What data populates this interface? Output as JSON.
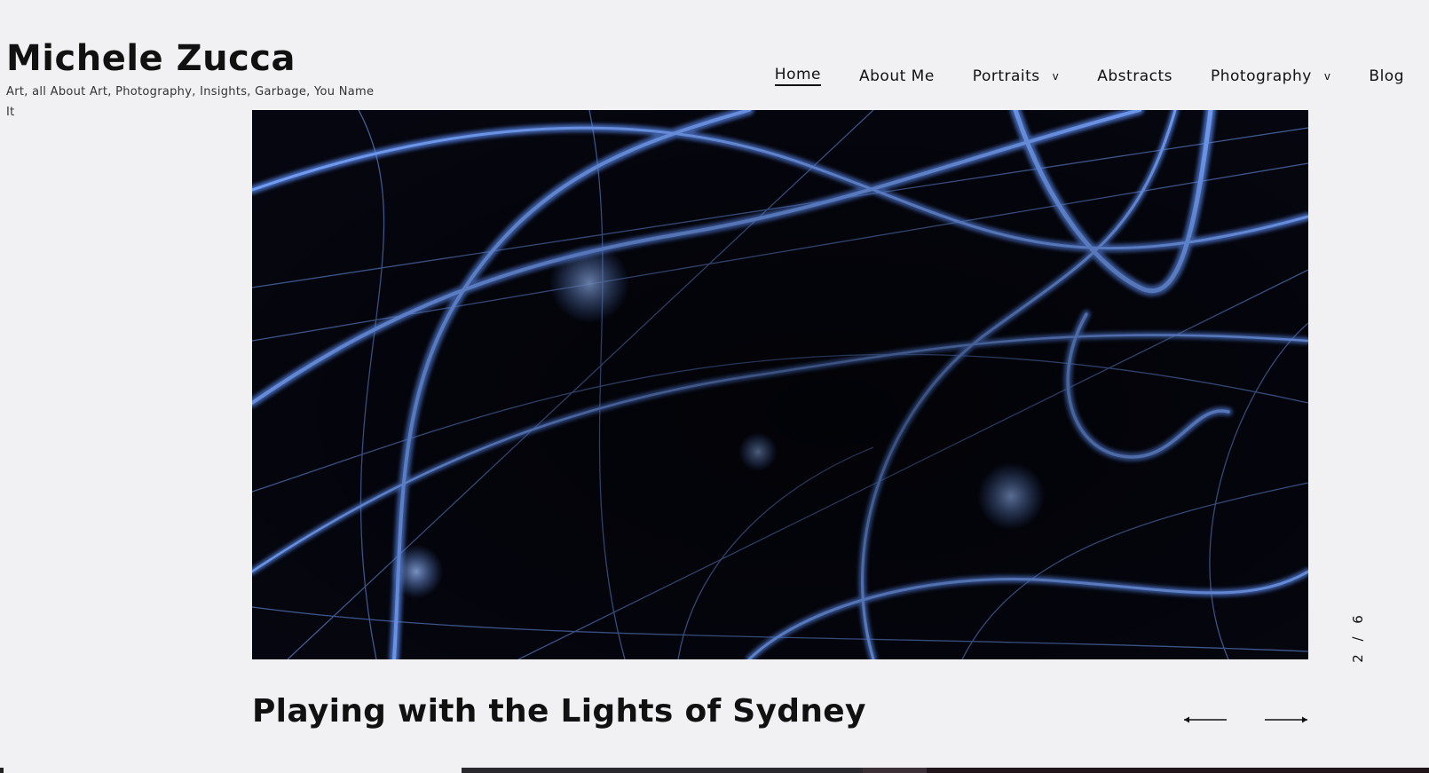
{
  "site": {
    "title": "Michele Zucca",
    "tagline": "Art, all About Art, Photography, Insights, Garbage, You Name It"
  },
  "nav": {
    "items": [
      {
        "label": "Home",
        "active": true,
        "dropdown": false
      },
      {
        "label": "About Me",
        "active": false,
        "dropdown": false
      },
      {
        "label": "Portraits",
        "active": false,
        "dropdown": true
      },
      {
        "label": "Abstracts",
        "active": false,
        "dropdown": false
      },
      {
        "label": "Photography",
        "active": false,
        "dropdown": true
      },
      {
        "label": "Blog",
        "active": false,
        "dropdown": false
      }
    ],
    "chevron": "v"
  },
  "slideshow": {
    "current": "2",
    "separator": "/",
    "total": "6",
    "slide_title": "Playing with the Lights of Sydney",
    "image_semantic": "blue-light-trails-photo",
    "prev_icon": "arrow-left-icon",
    "next_icon": "arrow-right-icon"
  },
  "colors": {
    "background": "#f1f1f4",
    "text": "#111111",
    "light_trail": "#5b8df5",
    "photo_dark": "#03040c"
  }
}
